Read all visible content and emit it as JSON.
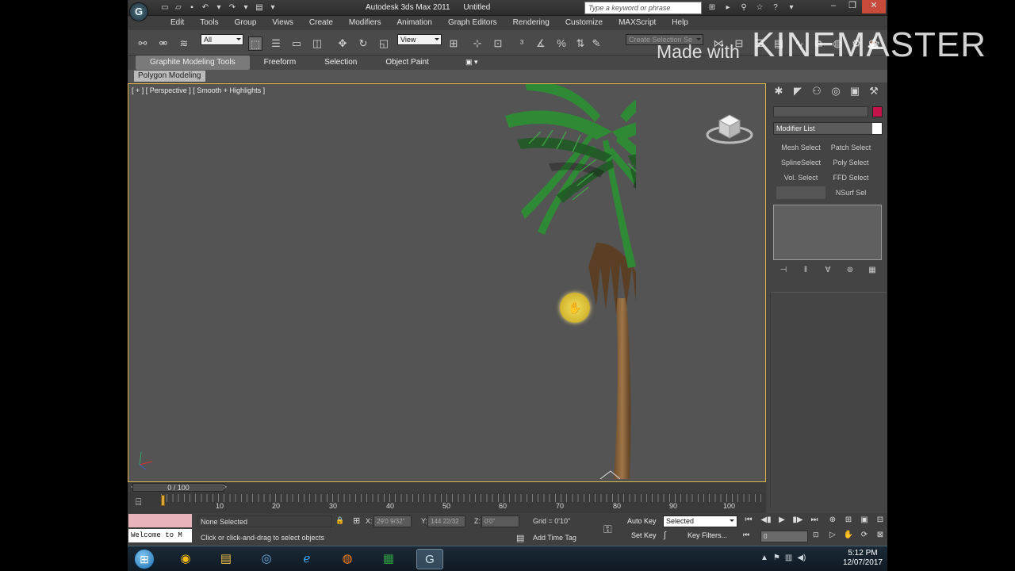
{
  "window": {
    "title": "Autodesk 3ds Max 2011",
    "doc_title": "Untitled",
    "search_placeholder": "Type a keyword or phrase",
    "app_logo": "G"
  },
  "menu": [
    "Edit",
    "Tools",
    "Group",
    "Views",
    "Create",
    "Modifiers",
    "Animation",
    "Graph Editors",
    "Rendering",
    "Customize",
    "MAXScript",
    "Help"
  ],
  "toolbar": {
    "filter_value": "All",
    "coord_value": "View",
    "named_selection_placeholder": "Create Selection Se"
  },
  "ribbon": {
    "tabs": [
      "Graphite Modeling Tools",
      "Freeform",
      "Selection",
      "Object Paint"
    ],
    "active_tab": "Graphite Modeling Tools",
    "subtab": "Polygon Modeling"
  },
  "viewport": {
    "label": "[ + ] [ Perspective ] [ Smooth + Highlights ]"
  },
  "timeline": {
    "slider_label": "0 / 100",
    "prev": "<",
    "next": ">",
    "ticks": [
      "10",
      "20",
      "30",
      "40",
      "50",
      "60",
      "70",
      "80",
      "90",
      "100"
    ]
  },
  "status": {
    "welcome": "Welcome to M",
    "selection": "None Selected",
    "prompt": "Click or click-and-drag to select objects",
    "x_label": "X:",
    "x_value": "29'0 9/32\"",
    "y_label": "Y:",
    "y_value": "144 22/32",
    "z_label": "Z:",
    "z_value": "0'0\"",
    "grid": "Grid = 0'10\"",
    "add_time_tag": "Add Time Tag",
    "auto_key": "Auto Key",
    "set_key": "Set Key",
    "key_mode": "Selected",
    "key_filters": "Key Filters...",
    "frame": "0"
  },
  "command_panel": {
    "modifier_list": "Modifier List",
    "buttons": [
      "Mesh Select",
      "Patch Select",
      "SplineSelect",
      "Poly Select",
      "Vol. Select",
      "FFD Select",
      "NSurf Sel"
    ]
  },
  "taskbar": {
    "time": "5:12 PM",
    "date": "12/07/2017"
  },
  "watermark": {
    "made_with": "Made with",
    "brand": "KINEMASTER"
  },
  "colors": {
    "accent_viewport_border": "#d9b64a",
    "color_swatch": "#c5134a",
    "welcome_bg": "#e8b3bb"
  }
}
